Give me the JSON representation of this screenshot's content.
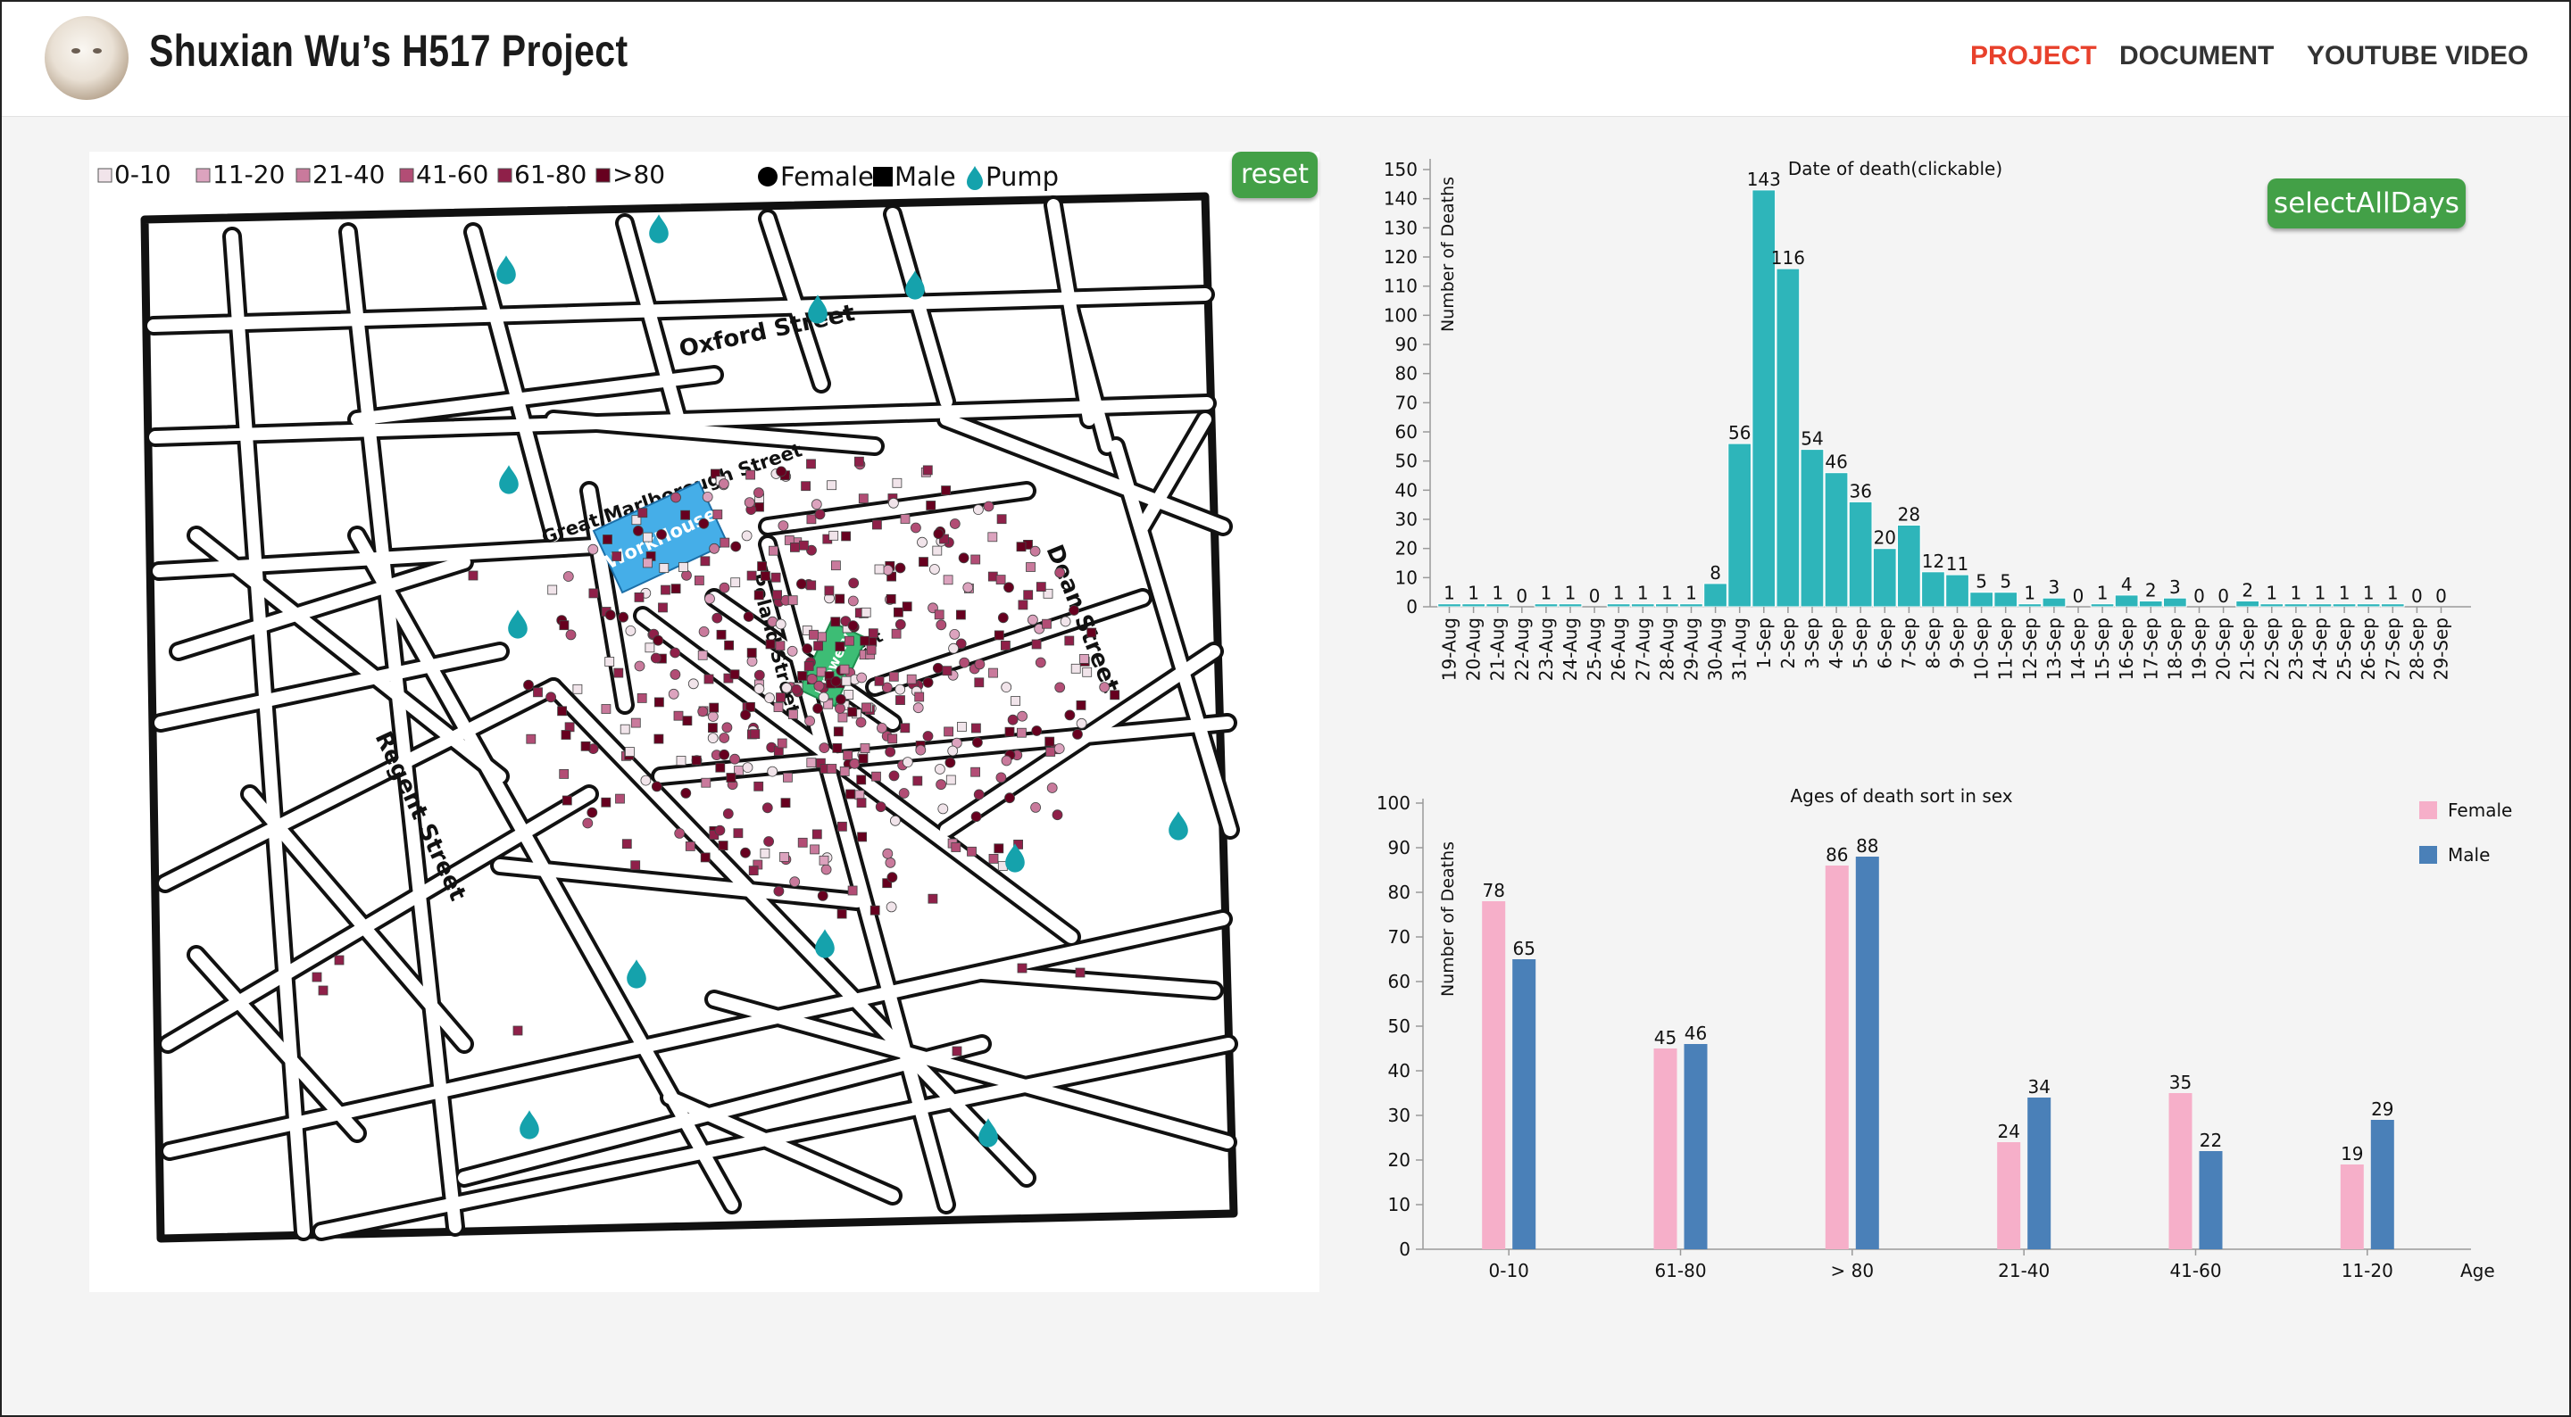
{
  "header": {
    "title": "Shuxian Wu’s H517 Project",
    "nav": [
      {
        "label": "PROJECT",
        "active": true
      },
      {
        "label": "DOCUMENT",
        "active": false
      },
      {
        "label": "YOUTUBE VIDEO",
        "active": false
      }
    ]
  },
  "map": {
    "reset_label": "reset",
    "age_legend": [
      {
        "label": "0-10",
        "color": "#f1e4ea"
      },
      {
        "label": "11-20",
        "color": "#dca3be"
      },
      {
        "label": "21-40",
        "color": "#c97a9c"
      },
      {
        "label": "41-60",
        "color": "#b24d75"
      },
      {
        "label": "61-80",
        "color": "#8f2049"
      },
      {
        "label": ">80",
        "color": "#67001f"
      }
    ],
    "sex_legend": [
      {
        "label": "Female",
        "icon": "circle-icon"
      },
      {
        "label": "Male",
        "icon": "square-icon"
      }
    ],
    "pump_label": "Pump",
    "pump_color": "#15a2ac",
    "workhouse_label": "WorkHouse",
    "workhouse_color": "#45aee8",
    "brewery_label": "Brewery",
    "brewery_color": "#3dbd75",
    "street_labels": [
      "Oxford Street",
      "Great Marlborough Street",
      "Poland Street",
      "Dean Street",
      "Regent Street",
      "Broad Street"
    ]
  },
  "chart_data": [
    {
      "type": "bar",
      "title": "Date of death(clickable)",
      "ylabel": "Number of Deaths",
      "xlabel": "",
      "ylim": [
        0,
        150
      ],
      "yticks": [
        0,
        10,
        20,
        30,
        40,
        50,
        60,
        70,
        80,
        90,
        100,
        110,
        120,
        130,
        140,
        150
      ],
      "color": "#2eb5ba",
      "button_label": "selectAllDays",
      "categories": [
        "19-Aug",
        "20-Aug",
        "21-Aug",
        "22-Aug",
        "23-Aug",
        "24-Aug",
        "25-Aug",
        "26-Aug",
        "27-Aug",
        "28-Aug",
        "29-Aug",
        "30-Aug",
        "31-Aug",
        "1-Sep",
        "2-Sep",
        "3-Sep",
        "4-Sep",
        "5-Sep",
        "6-Sep",
        "7-Sep",
        "8-Sep",
        "9-Sep",
        "10-Sep",
        "11-Sep",
        "12-Sep",
        "13-Sep",
        "14-Sep",
        "15-Sep",
        "16-Sep",
        "17-Sep",
        "18-Sep",
        "19-Sep",
        "20-Sep",
        "21-Sep",
        "22-Sep",
        "23-Sep",
        "24-Sep",
        "25-Sep",
        "26-Sep",
        "27-Sep",
        "28-Sep",
        "29-Sep"
      ],
      "values": [
        1,
        1,
        1,
        0,
        1,
        1,
        0,
        1,
        1,
        1,
        1,
        8,
        56,
        143,
        116,
        54,
        46,
        36,
        20,
        28,
        12,
        11,
        5,
        5,
        1,
        3,
        0,
        1,
        4,
        2,
        3,
        0,
        0,
        2,
        1,
        1,
        1,
        1,
        1,
        1,
        0,
        0
      ]
    },
    {
      "type": "bar",
      "title": "Ages of death sort in sex",
      "ylabel": "Number of Deaths",
      "xlabel": "Age",
      "ylim": [
        0,
        100
      ],
      "yticks": [
        0,
        10,
        20,
        30,
        40,
        50,
        60,
        70,
        80,
        90,
        100
      ],
      "categories": [
        "0-10",
        "61-80",
        "> 80",
        "21-40",
        "41-60",
        "11-20"
      ],
      "series": [
        {
          "name": "Female",
          "color": "#f6afc9",
          "values": [
            78,
            45,
            86,
            24,
            35,
            19
          ]
        },
        {
          "name": "Male",
          "color": "#4a80b8",
          "values": [
            65,
            46,
            88,
            34,
            22,
            29
          ]
        }
      ]
    }
  ]
}
